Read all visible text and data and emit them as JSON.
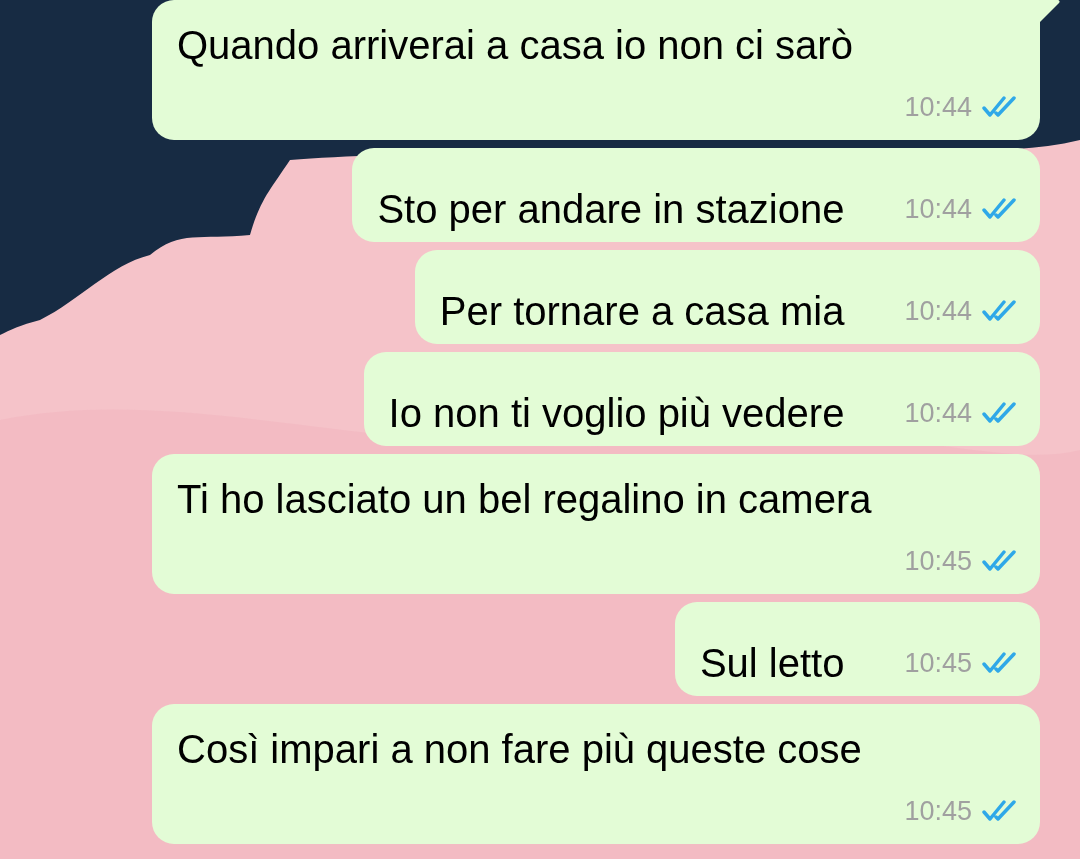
{
  "messages": [
    {
      "text": "Quando arriverai a casa io non ci sarò",
      "time": "10:44",
      "read": true,
      "tail": true
    },
    {
      "text": "Sto per andare in stazione",
      "time": "10:44",
      "read": true,
      "tail": false
    },
    {
      "text": "Per tornare a casa mia",
      "time": "10:44",
      "read": true,
      "tail": false
    },
    {
      "text": "Io non ti voglio più vedere",
      "time": "10:44",
      "read": true,
      "tail": false
    },
    {
      "text": "Ti ho lasciato un bel regalino in camera",
      "time": "10:45",
      "read": true,
      "tail": false
    },
    {
      "text": "Sul letto",
      "time": "10:45",
      "read": true,
      "tail": false
    },
    {
      "text": "Così impari a non fare più queste cose",
      "time": "10:45",
      "read": true,
      "tail": false
    }
  ]
}
